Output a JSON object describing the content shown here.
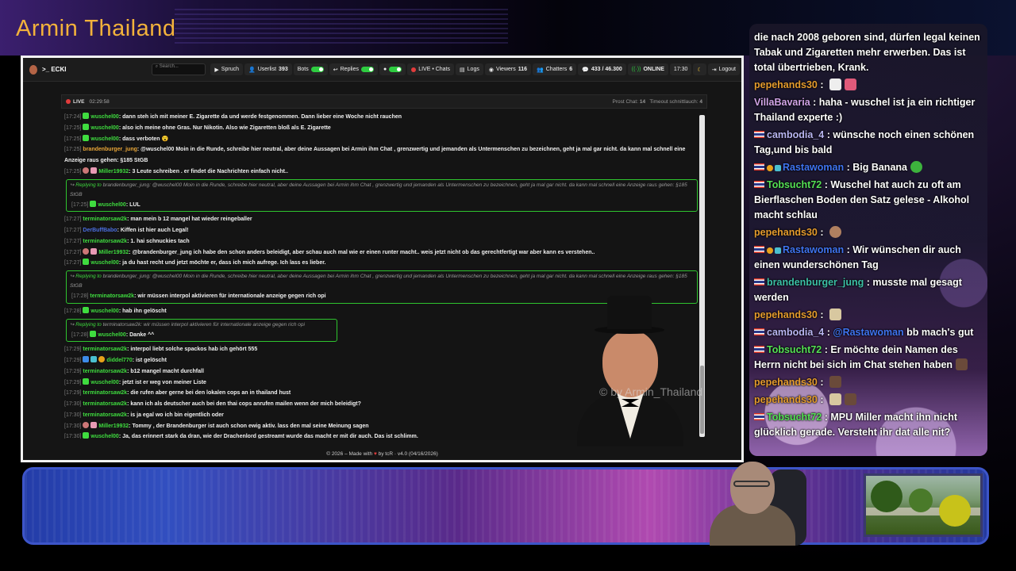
{
  "overlay": {
    "stream_title": "Armin Thailand",
    "watermark": "© by Armin_Thailand"
  },
  "app": {
    "brand": ">_ ECKI",
    "nav": {
      "search_placeholder": "Search...",
      "spruch": "Spruch",
      "userlist_label": "Userlist",
      "userlist_count": "393",
      "bots": "Bots",
      "replies": "Replies",
      "live_chats": "LIVE • Chats",
      "logs": "Logs",
      "viewers_label": "Viewers",
      "viewers_count": "116",
      "chatters_label": "Chatters",
      "chatters_count": "6",
      "messages": "433 / 46.300",
      "status": "ONLINE",
      "time": "17:30",
      "logout": "Logout"
    },
    "live_bar": {
      "live": "LIVE",
      "timer": "02:29:58",
      "prost_label": "Prost Chat:",
      "prost_count": "14",
      "timeout_label": "Timeout schnittlauch:",
      "timeout_count": "4"
    },
    "messages": [
      {
        "ts": "[17:24]",
        "badges": [
          "green"
        ],
        "user": "wuschel00",
        "color": "green",
        "text": "dann steh ich mit meiner E. Zigarette da und werde festgenommen. Dann lieber eine Woche nicht rauchen"
      },
      {
        "ts": "[17:25]",
        "badges": [
          "green"
        ],
        "user": "wuschel00",
        "color": "green",
        "text": "also ich meine ohne Gras. Nur Nikotin. Also wie Zigaretten bloß als E. Zigarette"
      },
      {
        "ts": "[17:25]",
        "badges": [
          "green"
        ],
        "user": "wuschel00",
        "color": "green",
        "text": "dass verboten 😮"
      },
      {
        "ts": "[17:25]",
        "badges": [],
        "user": "brandenburger_jung",
        "color": "orange",
        "wrap": true,
        "text": "@wuschel00 Moin in die Runde, schreibe hier neutral, aber deine Aussagen bei Armin ihm Chat , grenzwertig und jemanden als Untermenschen zu bezeichnen, geht ja mal gar nicht. da kann mal schnell eine Anzeige raus gehen: §185 StGB"
      },
      {
        "ts": "[17:25]",
        "badges": [
          "round",
          "pink"
        ],
        "user": "Miller19932",
        "color": "green",
        "text": "3 Leute schreiben . er findet die Nachrichten einfach nicht.."
      },
      {
        "reply": true,
        "reply_label": "Replying to",
        "reply_text": "brandenburger_jung: @wuschel00 Moin in die Runde, schreibe hier neutral, aber deine Aussagen bei Armin ihm Chat , grenzwertig und jemanden als Untermenschen zu bezeichnen, geht ja mal gar nicht. da kann mal schnell eine Anzeige raus gehen: §185 StGB",
        "ts": "[17:25]",
        "badges": [
          "green"
        ],
        "user": "wuschel00",
        "color": "green",
        "text": "LUL"
      },
      {
        "ts": "[17:27]",
        "badges": [],
        "user": "terminatorsaw2k",
        "color": "green",
        "text": "man mein b 12 mangel hat wieder reingeballer"
      },
      {
        "ts": "[17:27]",
        "badges": [],
        "user": "DerBuffBabo",
        "color": "blue",
        "text": "Kiffen ist hier auch Legal!"
      },
      {
        "ts": "[17:27]",
        "badges": [],
        "user": "terminatorsaw2k",
        "color": "green",
        "text": "1. hai schnuckies tach"
      },
      {
        "ts": "[17:27]",
        "badges": [
          "round",
          "pink"
        ],
        "user": "Miller19932",
        "color": "green",
        "text": "@brandenburger_jung ich habe den schon anders beleidigt, aber schau auch mal wie er einen runter macht.. weis jetzt nicht ob das gerechtfertigt war aber kann es verstehen.."
      },
      {
        "ts": "[17:27]",
        "badges": [
          "green"
        ],
        "user": "wuschel00",
        "color": "green",
        "text": "ja du hast recht und jetzt möchte er, dass ich mich aufrege. Ich lass es lieber."
      },
      {
        "reply": true,
        "reply_label": "Replying to",
        "reply_text": "brandenburger_jung: @wuschel00 Moin in die Runde, schreibe hier neutral, aber deine Aussagen bei Armin ihm Chat , grenzwertig und jemanden als Untermenschen zu bezeichnen, geht ja mal gar nicht. da kann mal schnell eine Anzeige raus gehen: §185 StGB",
        "ts": "[17:28]",
        "badges": [],
        "user": "terminatorsaw2k",
        "color": "green",
        "text": "wir müssen interpol aktivieren für internationale anzeige gegen rich opi"
      },
      {
        "ts": "[17:28]",
        "badges": [
          "green"
        ],
        "user": "wuschel00",
        "color": "green",
        "text": "hab ihn gelöscht"
      },
      {
        "reply": true,
        "short": true,
        "reply_label": "Replying to",
        "reply_text": "terminatorsaw2k: wir müssen interpol aktivieren für internationale anzeige gegen rich opi",
        "ts": "[17:28]",
        "badges": [
          "green"
        ],
        "user": "wuschel00",
        "color": "green",
        "text": "Danke ^^"
      },
      {
        "ts": "[17:29]",
        "badges": [],
        "user": "terminatorsaw2k",
        "color": "green",
        "text": "interpol liebt solche spackos hab ich gehört 555"
      },
      {
        "ts": "[17:29]",
        "badges": [
          "blue",
          "cyan",
          "gold"
        ],
        "user": "diddel770",
        "color": "green",
        "text": "ist gelöscht"
      },
      {
        "ts": "[17:29]",
        "badges": [],
        "user": "terminatorsaw2k",
        "color": "green",
        "text": "b12 mangel macht durchfall"
      },
      {
        "ts": "[17:29]",
        "badges": [
          "green"
        ],
        "user": "wuschel00",
        "color": "green",
        "text": "jetzt ist er weg von meiner Liste"
      },
      {
        "ts": "[17:29]",
        "badges": [],
        "user": "terminatorsaw2k",
        "color": "green",
        "text": "die rufen aber gerne bei den lokalen cops an in thailand hust"
      },
      {
        "ts": "[17:30]",
        "badges": [],
        "user": "terminatorsaw2k",
        "color": "green",
        "text": "kann ich als deutscher auch bei den thai cops anrufen mailen wenn der mich beleidigt?"
      },
      {
        "ts": "[17:30]",
        "badges": [],
        "user": "terminatorsaw2k",
        "color": "green",
        "text": "is ja egal wo ich bin eigentlich oder"
      },
      {
        "ts": "[17:30]",
        "badges": [
          "round",
          "pink"
        ],
        "user": "Miller19932",
        "color": "green",
        "text": "Tommy , der Brandenburger ist auch schon ewig aktiv. lass den mal seine Meinung sagen"
      },
      {
        "ts": "[17:30]",
        "badges": [
          "green"
        ],
        "user": "wuschel00",
        "color": "green",
        "text": "Ja, das erinnert stark da dran, wie der Drachenlord gestreamt wurde das macht er mit dir auch. Das ist schlimm."
      }
    ],
    "footer": {
      "prefix": "© 2026 – Made with",
      "heart": "♥",
      "suffix": "by tcR · v4.0 (04/16/2026)"
    }
  },
  "side_chat": [
    {
      "flag": false,
      "user": "",
      "color": "",
      "text": "die nach 2008 geboren sind, dürfen legal keinen Tabak und Zigaretten mehr erwerben. Das ist total übertrieben, Krank.",
      "emojis": []
    },
    {
      "flag": false,
      "user": "pepehands30",
      "color": "orange",
      "text": "",
      "emojis": [
        "e-ghost",
        "e-hat"
      ]
    },
    {
      "flag": false,
      "user": "VillaBavaria",
      "color": "pink",
      "text": "haha - wuschel ist ja ein richtiger Thailand experte :)",
      "emojis": []
    },
    {
      "flag": true,
      "user": "cambodia_4",
      "color": "lav",
      "text": "wünsche noch einen schönen Tag,und bis bald",
      "emojis": []
    },
    {
      "flag": true,
      "extra_badges": true,
      "user": "Rastawoman",
      "color": "blue",
      "text": "Big Banana",
      "emojis": [
        "e-green"
      ]
    },
    {
      "flag": true,
      "user": "Tobsucht72",
      "color": "green",
      "text": "Wuschel hat auch zu oft am Bierflaschen Boden den Satz gelese - Alkohol macht schlau",
      "emojis": []
    },
    {
      "flag": false,
      "user": "pepehands30",
      "color": "orange",
      "text": "",
      "emojis": [
        "e-face"
      ]
    },
    {
      "flag": true,
      "extra_badges": true,
      "user": "Rastawoman",
      "color": "blue",
      "text": "Wir wünschen dir auch einen wunderschönen Tag",
      "emojis": []
    },
    {
      "flag": true,
      "user": "brandenburger_jung",
      "color": "teal",
      "text": "musste mal gesagt werden",
      "emojis": []
    },
    {
      "flag": false,
      "user": "pepehands30",
      "color": "orange",
      "text": "",
      "emojis": [
        "e-cup"
      ]
    },
    {
      "flag": true,
      "user": "cambodia_4",
      "color": "lav",
      "text": "",
      "mention": "@Rastawoman",
      "tail": " bb mach's gut",
      "emojis": []
    },
    {
      "flag": true,
      "user": "Tobsucht72",
      "color": "green",
      "text": "Er möchte dein Namen des Herrn nicht bei sich im Chat stehen haben",
      "emojis": [
        "e-man"
      ]
    },
    {
      "flag": false,
      "user": "pepehands30",
      "color": "orange",
      "text": "",
      "emojis": [
        "e-man"
      ]
    },
    {
      "flag": false,
      "user": "pepehands30",
      "color": "orange",
      "text": "",
      "emojis": [
        "e-cup",
        "e-man"
      ]
    },
    {
      "flag": true,
      "user": "Tobsucht72",
      "color": "green",
      "text": "MPU Miller macht ihn nicht glücklich gerade. Versteht ihr dat alle nit?",
      "emojis": []
    }
  ]
}
